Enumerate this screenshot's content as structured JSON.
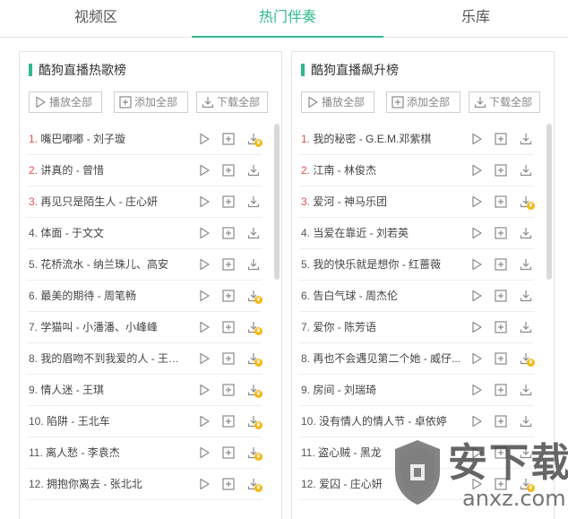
{
  "tabs": [
    {
      "label": "视频区",
      "active": false
    },
    {
      "label": "热门伴奏",
      "active": true
    },
    {
      "label": "乐库",
      "active": false
    }
  ],
  "accent_color": "#2fb98a",
  "rank_highlight_color": "#e05050",
  "action_buttons": {
    "play_all": "播放全部",
    "add_all": "添加全部",
    "download_all": "下载全部"
  },
  "icons": {
    "play": "play-icon",
    "add": "plus-square-icon",
    "download": "download-icon",
    "paid_badge": "coin-icon"
  },
  "left_panel": {
    "title": "酷狗直播热歌榜",
    "songs": [
      {
        "rank": "1.",
        "title": "嘴巴嘟嘟 - 刘子璇",
        "paid": true
      },
      {
        "rank": "2.",
        "title": "讲真的 - 曾惜",
        "paid": false
      },
      {
        "rank": "3.",
        "title": "再见只是陌生人 - 庄心妍",
        "paid": false
      },
      {
        "rank": "4.",
        "title": "体面 - 于文文",
        "paid": false
      },
      {
        "rank": "5.",
        "title": "花桥流水 - 纳兰珠儿、高安",
        "paid": false
      },
      {
        "rank": "6.",
        "title": "最美的期待 - 周笔畅",
        "paid": true
      },
      {
        "rank": "7.",
        "title": "学猫叫 - 小潘潘、小峰峰",
        "paid": true
      },
      {
        "rank": "8.",
        "title": "我的眉吻不到我爱的人 - 王奕心",
        "paid": true
      },
      {
        "rank": "9.",
        "title": "情人迷 - 王琪",
        "paid": true
      },
      {
        "rank": "10.",
        "title": "陷阱 - 王北车",
        "paid": true
      },
      {
        "rank": "11.",
        "title": "离人愁 - 李袁杰",
        "paid": true
      },
      {
        "rank": "12.",
        "title": "拥抱你离去 - 张北北",
        "paid": true
      }
    ]
  },
  "right_panel": {
    "title": "酷狗直播飙升榜",
    "songs": [
      {
        "rank": "1.",
        "title": "我的秘密 - G.E.M.邓紫棋",
        "paid": false
      },
      {
        "rank": "2.",
        "title": "江南 - 林俊杰",
        "paid": false
      },
      {
        "rank": "3.",
        "title": "爱河 - 神马乐团",
        "paid": true
      },
      {
        "rank": "4.",
        "title": "当爱在靠近 - 刘若英",
        "paid": false
      },
      {
        "rank": "5.",
        "title": "我的快乐就是想你 - 红蔷薇",
        "paid": false
      },
      {
        "rank": "6.",
        "title": "告白气球 - 周杰伦",
        "paid": false
      },
      {
        "rank": "7.",
        "title": "爱你 - 陈芳语",
        "paid": false
      },
      {
        "rank": "8.",
        "title": "再也不会遇见第二个她 - 威仔...",
        "paid": true
      },
      {
        "rank": "9.",
        "title": "房间 - 刘瑞琦",
        "paid": false
      },
      {
        "rank": "10.",
        "title": "没有情人的情人节 - 卓依婷",
        "paid": false
      },
      {
        "rank": "11.",
        "title": "盗心贼 - 黑龙",
        "paid": false
      },
      {
        "rank": "12.",
        "title": "爱囚 - 庄心妍",
        "paid": true
      }
    ]
  },
  "watermark": {
    "brand": "安下载",
    "url": "anxz.com"
  }
}
